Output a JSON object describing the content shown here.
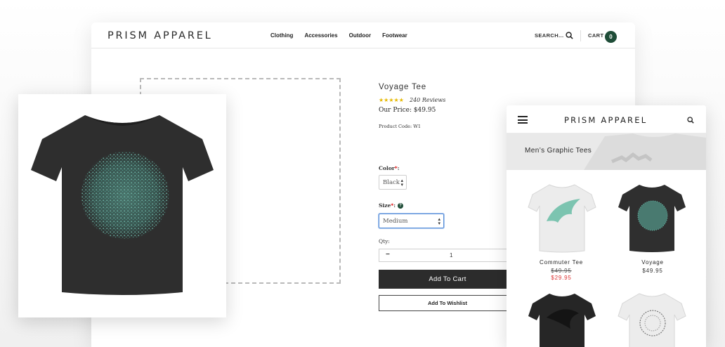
{
  "desktop": {
    "brand": "PRISM APPAREL",
    "nav": [
      "Clothing",
      "Accessories",
      "Outdoor",
      "Footwear"
    ],
    "search_label": "SEARCH...",
    "cart_label": "CART",
    "cart_count": "0"
  },
  "product": {
    "title": "Voyage Tee",
    "stars": "★★★★★",
    "reviews": "240 Reviews",
    "price": "Our Price: $49.95",
    "code": "Product Code: W1",
    "color_label": "Color",
    "color_value": "Black",
    "size_label": "Size",
    "size_value": "Medium",
    "qty_label": "Qty:",
    "qty_value": "1",
    "qty_minus": "−",
    "add_to_cart": "Add To Cart",
    "add_to_wishlist": "Add To Wishlist"
  },
  "mobile": {
    "brand": "PRISM APPAREL",
    "banner_title": "Men’s Graphic Tees",
    "tiles": [
      {
        "name": "Commuter Tee",
        "was": "$49.95",
        "now": "$29.95"
      },
      {
        "name": "Voyage",
        "price": "$49.95"
      }
    ]
  },
  "colors": {
    "accent": "#1f4d38",
    "button_dark": "#2c2c2c",
    "sale_red": "#dd3333",
    "tee_teal": "#5fb8a6"
  }
}
